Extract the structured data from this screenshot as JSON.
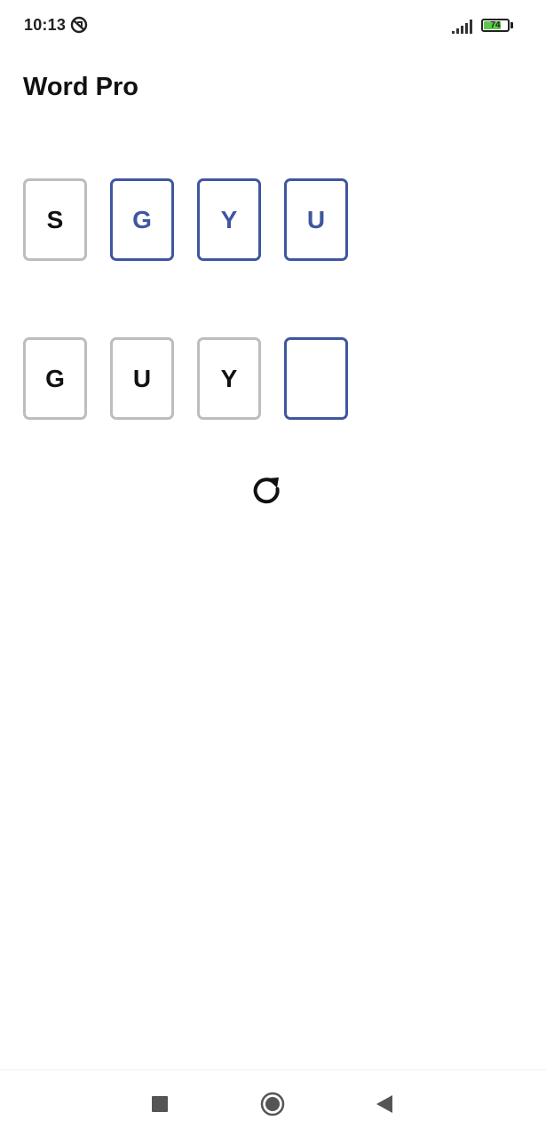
{
  "status_bar": {
    "time": "10:13",
    "battery_level": "74",
    "battery_fraction": 0.74
  },
  "app": {
    "title": "Word Pro"
  },
  "source_row": {
    "tiles": [
      {
        "letter": "S",
        "state": "used"
      },
      {
        "letter": "G",
        "state": "available"
      },
      {
        "letter": "Y",
        "state": "available"
      },
      {
        "letter": "U",
        "state": "available"
      }
    ]
  },
  "answer_row": {
    "tiles": [
      {
        "letter": "G",
        "state": "filled"
      },
      {
        "letter": "U",
        "state": "filled"
      },
      {
        "letter": "Y",
        "state": "filled"
      },
      {
        "letter": "",
        "state": "active-empty"
      }
    ]
  },
  "icons": {
    "refresh": "refresh-icon",
    "nav_recents": "square-icon",
    "nav_home": "circle-icon",
    "nav_back": "triangle-back-icon"
  },
  "colors": {
    "accent": "#3f56a0",
    "tile_border": "#bdbdbd",
    "battery": "#5cc94a"
  }
}
